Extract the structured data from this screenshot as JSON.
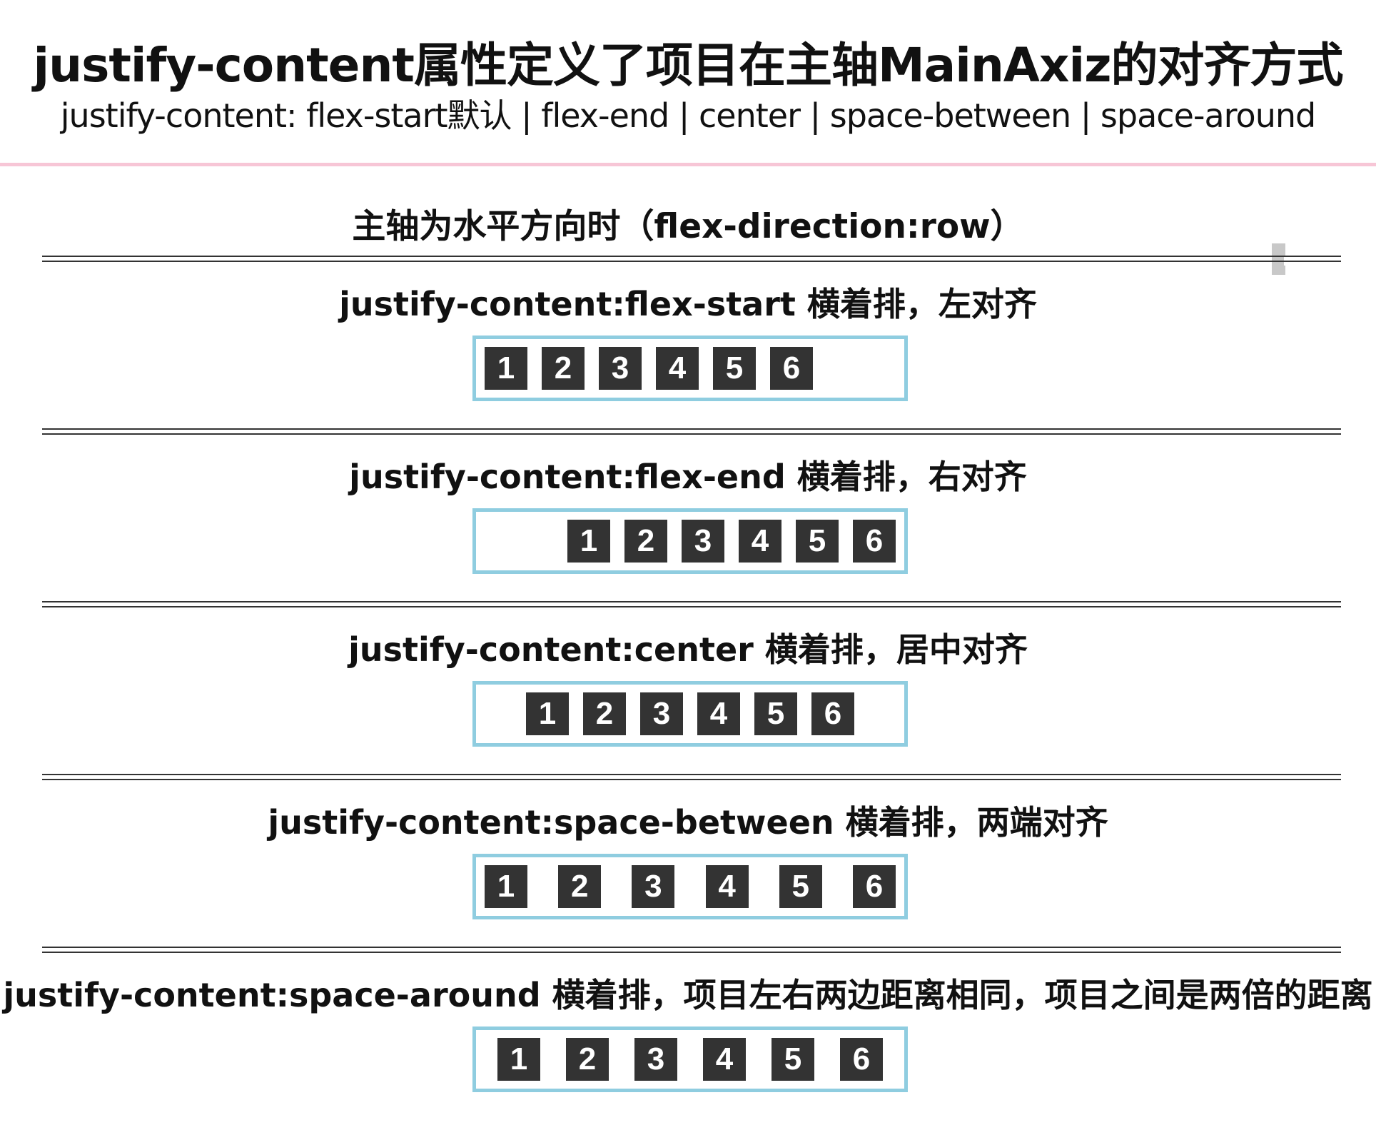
{
  "header": {
    "title": "justify-content属性定义了项目在主轴MainAxiz的对齐方式",
    "subtitle": "justify-content: flex-start默认 | flex-end | center | space-between | space-around"
  },
  "section_heading": "主轴为水平方向时（flex-direction:row）",
  "colors": {
    "item_bg": "#333333",
    "item_text": "#ffffff",
    "container_border": "#8fcde0",
    "header_rule": "#f7c6d6"
  },
  "demos": [
    {
      "label": "justify-content:flex-start 横着排，左对齐",
      "justify": "flex-start",
      "items": [
        "1",
        "2",
        "3",
        "4",
        "5",
        "6"
      ]
    },
    {
      "label": "justify-content:flex-end 横着排，右对齐",
      "justify": "flex-end",
      "items": [
        "1",
        "2",
        "3",
        "4",
        "5",
        "6"
      ]
    },
    {
      "label": "justify-content:center 横着排，居中对齐",
      "justify": "center",
      "items": [
        "1",
        "2",
        "3",
        "4",
        "5",
        "6"
      ]
    },
    {
      "label": "justify-content:space-between 横着排，两端对齐",
      "justify": "space-between",
      "items": [
        "1",
        "2",
        "3",
        "4",
        "5",
        "6"
      ]
    },
    {
      "label": "justify-content:space-around 横着排，项目左右两边距离相同，项目之间是两倍的距离",
      "justify": "space-around",
      "items": [
        "1",
        "2",
        "3",
        "4",
        "5",
        "6"
      ]
    }
  ]
}
